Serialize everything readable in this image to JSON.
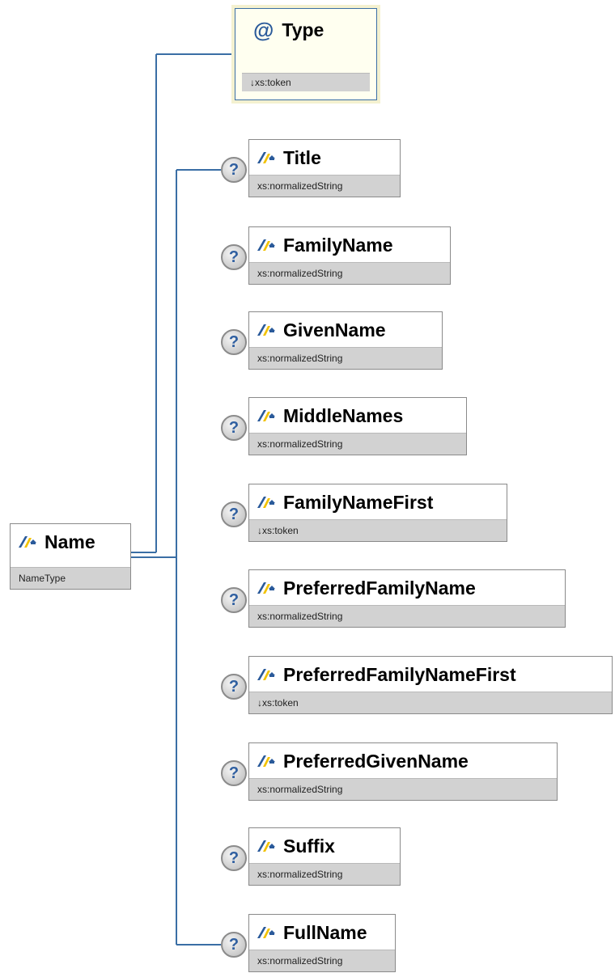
{
  "root": {
    "name": "Name",
    "type": "NameType"
  },
  "attribute": {
    "symbol": "@",
    "name": "Type",
    "type": "↓xs:token"
  },
  "optional_symbol": "?",
  "children": [
    {
      "name": "Title",
      "type": "xs:normalizedString"
    },
    {
      "name": "FamilyName",
      "type": "xs:normalizedString"
    },
    {
      "name": "GivenName",
      "type": "xs:normalizedString"
    },
    {
      "name": "MiddleNames",
      "type": "xs:normalizedString"
    },
    {
      "name": "FamilyNameFirst",
      "type": "↓xs:token"
    },
    {
      "name": "PreferredFamilyName",
      "type": "xs:normalizedString"
    },
    {
      "name": "PreferredFamilyNameFirst",
      "type": "↓xs:token"
    },
    {
      "name": "PreferredGivenName",
      "type": "xs:normalizedString"
    },
    {
      "name": "Suffix",
      "type": "xs:normalizedString"
    },
    {
      "name": "FullName",
      "type": "xs:normalizedString"
    }
  ],
  "colors": {
    "connector": "#3a6ea5",
    "icon_blue": "#2a5a9a",
    "icon_yellow": "#f2c200"
  }
}
